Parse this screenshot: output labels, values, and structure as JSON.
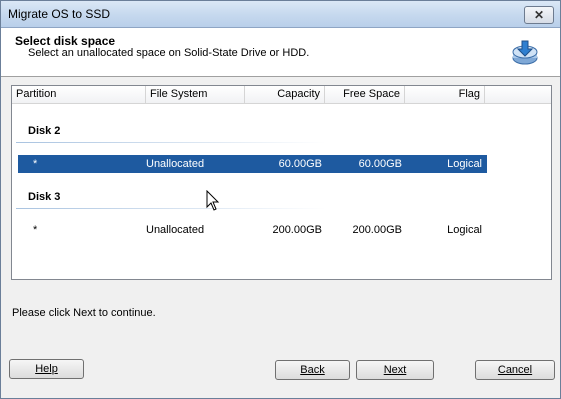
{
  "window": {
    "title": "Migrate OS to SSD"
  },
  "header": {
    "title": "Select disk space",
    "subtitle": "Select an unallocated space on Solid-State Drive or HDD."
  },
  "columns": [
    "Partition",
    "File System",
    "Capacity",
    "Free Space",
    "Flag"
  ],
  "disks": [
    {
      "label": "Disk 2",
      "rows": [
        {
          "partition": "*",
          "file_system": "Unallocated",
          "capacity": "60.00GB",
          "free_space": "60.00GB",
          "flag": "Logical",
          "selected": true
        }
      ]
    },
    {
      "label": "Disk 3",
      "rows": [
        {
          "partition": "*",
          "file_system": "Unallocated",
          "capacity": "200.00GB",
          "free_space": "200.00GB",
          "flag": "Logical",
          "selected": false
        }
      ]
    }
  ],
  "hint": "Please click Next to continue.",
  "buttons": {
    "help": "Help",
    "back": "Back",
    "next": "Next",
    "cancel": "Cancel"
  },
  "icons": {
    "close": "close-icon",
    "header": "disk-download-icon"
  },
  "colors": {
    "selection": "#1e5aa0"
  }
}
